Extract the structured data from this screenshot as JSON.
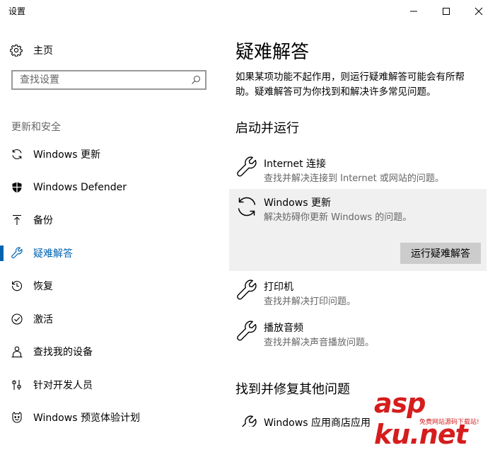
{
  "window": {
    "title": "设置"
  },
  "sidebar": {
    "home_label": "主页",
    "search_placeholder": "查找设置",
    "section_title": "更新和安全",
    "items": [
      {
        "label": "Windows 更新",
        "icon": "sync-icon",
        "active": false
      },
      {
        "label": "Windows Defender",
        "icon": "shield-icon",
        "active": false
      },
      {
        "label": "备份",
        "icon": "upload-arrow-icon",
        "active": false
      },
      {
        "label": "疑难解答",
        "icon": "wrench-icon",
        "active": true
      },
      {
        "label": "恢复",
        "icon": "history-icon",
        "active": false
      },
      {
        "label": "激活",
        "icon": "check-circle-icon",
        "active": false
      },
      {
        "label": "查找我的设备",
        "icon": "person-locate-icon",
        "active": false
      },
      {
        "label": "针对开发人员",
        "icon": "sliders-icon",
        "active": false
      },
      {
        "label": "Windows 预览体验计划",
        "icon": "smiley-icon",
        "active": false
      }
    ]
  },
  "main": {
    "title": "疑难解答",
    "description": "如果某项功能不起作用，则运行疑难解答可能会有所帮助。疑难解答可为你找到和解决许多常见问题。",
    "section1_title": "启动并运行",
    "troubleshooters": [
      {
        "name": "Internet 连接",
        "desc": "查找并解决连接到 Internet 或网站的问题。",
        "icon": "wrench-icon"
      },
      {
        "name": "Windows 更新",
        "desc": "解决妨碍你更新 Windows 的问题。",
        "icon": "sync-icon",
        "selected": true
      },
      {
        "name": "打印机",
        "desc": "查找并解决打印问题。",
        "icon": "wrench-icon"
      },
      {
        "name": "播放音频",
        "desc": "查找并解决声音播放问题。",
        "icon": "wrench-icon"
      }
    ],
    "run_button_label": "运行疑难解答",
    "section2_title": "找到并修复其他问题",
    "partial_item": {
      "name": "Windows 应用商店应用",
      "icon": "wrench-icon"
    }
  },
  "watermark": {
    "text": "asp ku.net",
    "sub": "免费网站源码下载站!"
  },
  "colors": {
    "accent": "#0063b1",
    "selected_bg": "#f0f0f0",
    "button_bg": "#cccccc",
    "watermark": "#d51d1d"
  }
}
